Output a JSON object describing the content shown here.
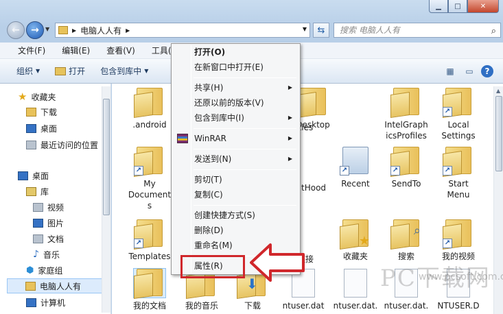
{
  "window": {
    "minimize_icon": "minimize-icon",
    "maximize_icon": "maximize-icon",
    "close_icon": "close-icon"
  },
  "address_bar": {
    "path": "电脑人人有",
    "search_placeholder": "搜索 电脑人人有"
  },
  "menubar": [
    "文件(F)",
    "编辑(E)",
    "查看(V)",
    "工具(T)"
  ],
  "toolbar": {
    "organize": "组织",
    "open": "打开",
    "include_library": "包含到库中"
  },
  "nav": {
    "favorites": "收藏夹",
    "downloads": "下载",
    "desktop_fav": "桌面",
    "recent": "最近访问的位置",
    "desktop": "桌面",
    "libraries": "库",
    "videos": "视频",
    "pictures": "图片",
    "documents": "文档",
    "music": "音乐",
    "homegroup": "家庭组",
    "user": "电脑人人有",
    "computer": "计算机"
  },
  "content": {
    "android": ".android",
    "cookies": "okies",
    "desktop": "Desktop",
    "intel1": "IntelGraph",
    "intel2": "icsProfiles",
    "local1": "Local",
    "local2": "Settings",
    "mydocs1": "My",
    "mydocs2": "Document",
    "mydocs3": "s",
    "nethood": "tHood",
    "recent": "Recent",
    "sendto": "SendTo",
    "start1": "Start",
    "start2": "Menu",
    "templates": "Templates",
    "links": "链接",
    "favorites": "收藏夹",
    "searches": "搜索",
    "videos": "我的视频",
    "mydocuments": "我的文档",
    "mymusic": "我的音乐",
    "downloads": "下载",
    "ntuser": "ntuser.dat",
    "ntuser2": "ntuser.dat.",
    "ntuser3": "ntuser.dat.",
    "ntuser4": "NTUSER.D"
  },
  "context_menu": {
    "open": "打开(O)",
    "open_new_window": "在新窗口中打开(E)",
    "share": "共享(H)",
    "restore": "还原以前的版本(V)",
    "include_library": "包含到库中(I)",
    "winrar": "WinRAR",
    "send_to": "发送到(N)",
    "cut": "剪切(T)",
    "copy": "复制(C)",
    "create_shortcut": "创建快捷方式(S)",
    "delete": "删除(D)",
    "rename": "重命名(M)",
    "properties": "属性(R)"
  },
  "watermark": {
    "big": "PC下载网",
    "small": "www.pcsoft.com.cn"
  },
  "colors": {
    "annotation_red": "#d0272b",
    "accent_blue": "#1f5bb5"
  }
}
